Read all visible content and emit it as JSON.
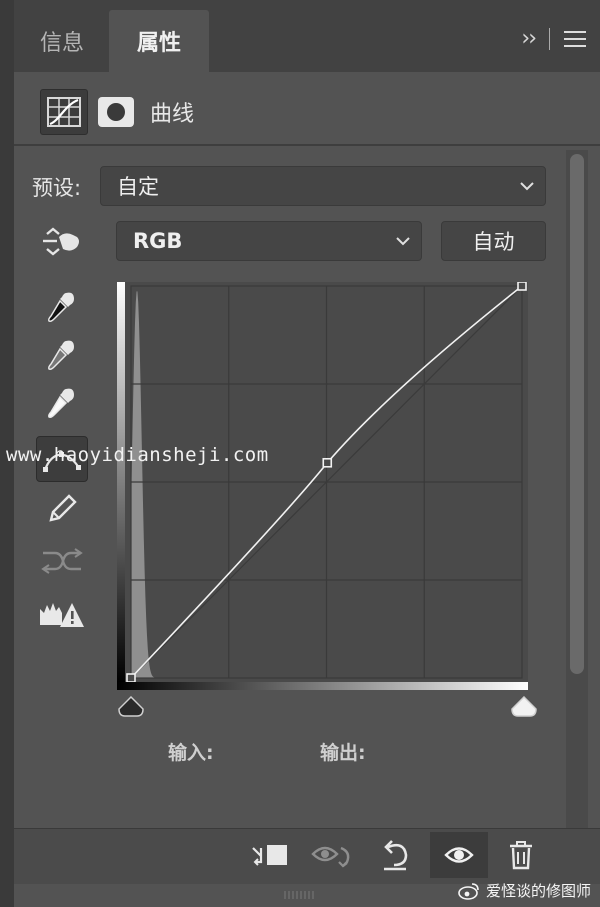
{
  "tabs": [
    {
      "label": "信息",
      "active": false
    },
    {
      "label": "属性",
      "active": true
    }
  ],
  "panel_title": "曲线",
  "preset": {
    "label": "预设:",
    "value": "自定"
  },
  "channel": {
    "value": "RGB"
  },
  "auto_label": "自动",
  "io": {
    "input_label": "输入:",
    "output_label": "输出:"
  },
  "watermark": "www.haoyidiansheji.com",
  "credit": "爱怪谈的修图师",
  "icons": {
    "collapse": "double-chevron-right-icon",
    "menu": "hamburger-menu-icon",
    "curves": "curves-adjustment-icon",
    "mask": "layer-mask-icon",
    "on_image": "on-image-adjust-hand-icon",
    "black_point": "black-point-eyedropper-icon",
    "gray_point": "gray-point-eyedropper-icon",
    "white_point": "white-point-eyedropper-icon",
    "edit_points": "edit-points-curve-icon",
    "draw": "pencil-draw-icon",
    "smooth": "smooth-curve-icon",
    "clipping": "clipping-warning-icon",
    "clip_to_layer": "clip-to-layer-icon",
    "view_previous": "view-previous-state-icon",
    "reset": "reset-icon",
    "visibility": "eye-visibility-icon",
    "delete": "trash-icon"
  },
  "curve": {
    "points": [
      [
        0,
        0
      ],
      [
        128,
        140
      ],
      [
        255,
        255
      ]
    ],
    "range": [
      0,
      255
    ]
  },
  "colors": {
    "panel_bg": "#535353",
    "tab_bg": "#424242",
    "graph_bg": "#474747"
  }
}
